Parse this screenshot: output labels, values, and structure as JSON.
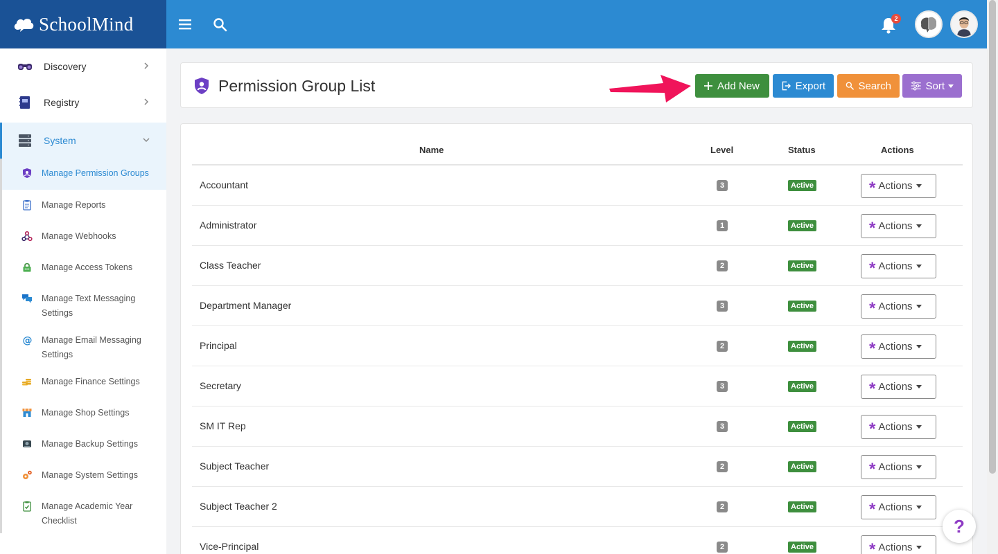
{
  "brand": {
    "name": "SchoolMind"
  },
  "topbar": {
    "notification_count": "2"
  },
  "sidebar": {
    "top_items": [
      {
        "label": "Discovery"
      },
      {
        "label": "Registry"
      },
      {
        "label": "System"
      }
    ],
    "sub_items": [
      {
        "label": "Manage Permission Groups"
      },
      {
        "label": "Manage Reports"
      },
      {
        "label": "Manage Webhooks"
      },
      {
        "label": "Manage Access Tokens"
      },
      {
        "label": "Manage Text Messaging Settings"
      },
      {
        "label": "Manage Email Messaging Settings"
      },
      {
        "label": "Manage Finance Settings"
      },
      {
        "label": "Manage Shop Settings"
      },
      {
        "label": "Manage Backup Settings"
      },
      {
        "label": "Manage System Settings"
      },
      {
        "label": "Manage Academic Year Checklist"
      }
    ]
  },
  "header": {
    "title": "Permission Group List",
    "add_label": "Add New",
    "export_label": "Export",
    "search_label": "Search",
    "sort_label": "Sort"
  },
  "table": {
    "columns": {
      "name": "Name",
      "level": "Level",
      "status": "Status",
      "actions": "Actions"
    },
    "rows": [
      {
        "name": "Accountant",
        "level": "3",
        "status": "Active",
        "action": "Actions"
      },
      {
        "name": "Administrator",
        "level": "1",
        "status": "Active",
        "action": "Actions"
      },
      {
        "name": "Class Teacher",
        "level": "2",
        "status": "Active",
        "action": "Actions"
      },
      {
        "name": "Department Manager",
        "level": "3",
        "status": "Active",
        "action": "Actions"
      },
      {
        "name": "Principal",
        "level": "2",
        "status": "Active",
        "action": "Actions"
      },
      {
        "name": "Secretary",
        "level": "3",
        "status": "Active",
        "action": "Actions"
      },
      {
        "name": "SM IT Rep",
        "level": "3",
        "status": "Active",
        "action": "Actions"
      },
      {
        "name": "Subject Teacher",
        "level": "2",
        "status": "Active",
        "action": "Actions"
      },
      {
        "name": "Subject Teacher 2",
        "level": "2",
        "status": "Active",
        "action": "Actions"
      },
      {
        "name": "Vice-Principal",
        "level": "2",
        "status": "Active",
        "action": "Actions"
      }
    ]
  },
  "help": {
    "label": "?"
  },
  "colors": {
    "brand": "#1a5296",
    "topbar": "#2c8ad2",
    "add": "#3e8f3e",
    "export": "#2c8ad2",
    "search": "#f0913a",
    "sort": "#9b6fcf",
    "accent": "#8e3bc4"
  }
}
